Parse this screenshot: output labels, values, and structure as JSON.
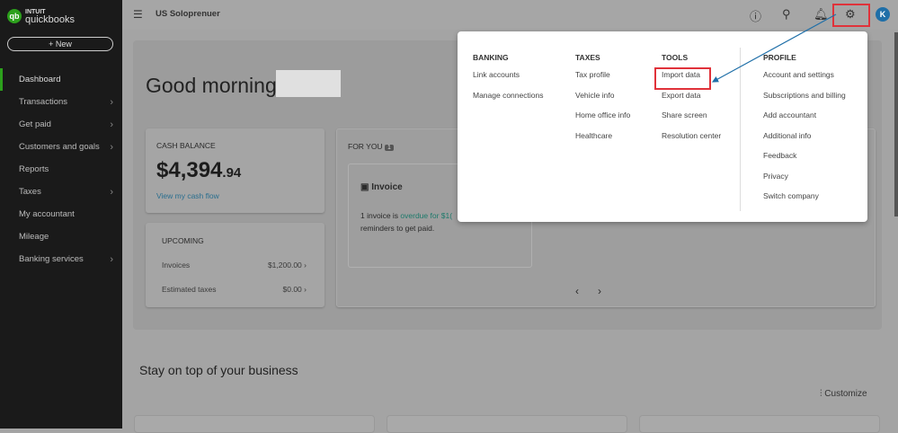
{
  "sidebar": {
    "logo_brand": "INTUIT",
    "logo_name": "quickbooks",
    "new_label": "+ New",
    "items": [
      {
        "label": "Dashboard"
      },
      {
        "label": "Transactions"
      },
      {
        "label": "Get paid"
      },
      {
        "label": "Customers and goals"
      },
      {
        "label": "Reports"
      },
      {
        "label": "Taxes"
      },
      {
        "label": "My accountant"
      },
      {
        "label": "Mileage"
      },
      {
        "label": "Banking services"
      }
    ]
  },
  "header": {
    "company": "US Soloprenuer",
    "avatar": "K"
  },
  "dashboard": {
    "greeting": "Good morning",
    "cash": {
      "title": "CASH BALANCE",
      "amount": "$4,394",
      "cents": ".94",
      "link": "View my cash flow"
    },
    "upcoming": {
      "title": "UPCOMING",
      "rows": [
        {
          "label": "Invoices",
          "value": "$1,200.00"
        },
        {
          "label": "Estimated taxes",
          "value": "$0.00"
        }
      ]
    },
    "for_you": {
      "title": "FOR YOU",
      "count": "1",
      "card_title": "Invoice",
      "text1": "1 invoice is ",
      "link": "overdue for $1(",
      "text2": "reminders to get paid."
    },
    "stay_title": "Stay on top of your business",
    "customize": "Customize"
  },
  "menu": {
    "banking": {
      "title": "BANKING",
      "items": [
        "Link accounts",
        "Manage connections"
      ]
    },
    "taxes": {
      "title": "TAXES",
      "items": [
        "Tax profile",
        "Vehicle info",
        "Home office info",
        "Healthcare"
      ]
    },
    "tools": {
      "title": "TOOLS",
      "items": [
        "Import data",
        "Export data",
        "Share screen",
        "Resolution center"
      ]
    },
    "profile": {
      "title": "PROFILE",
      "items": [
        "Account and settings",
        "Subscriptions and billing",
        "Add accountant",
        "Additional info",
        "Feedback",
        "Privacy",
        "Switch company"
      ]
    }
  },
  "colors": {
    "accent": "#2ca01c",
    "highlight": "#e0323a",
    "arrow": "#1f6fa8"
  }
}
